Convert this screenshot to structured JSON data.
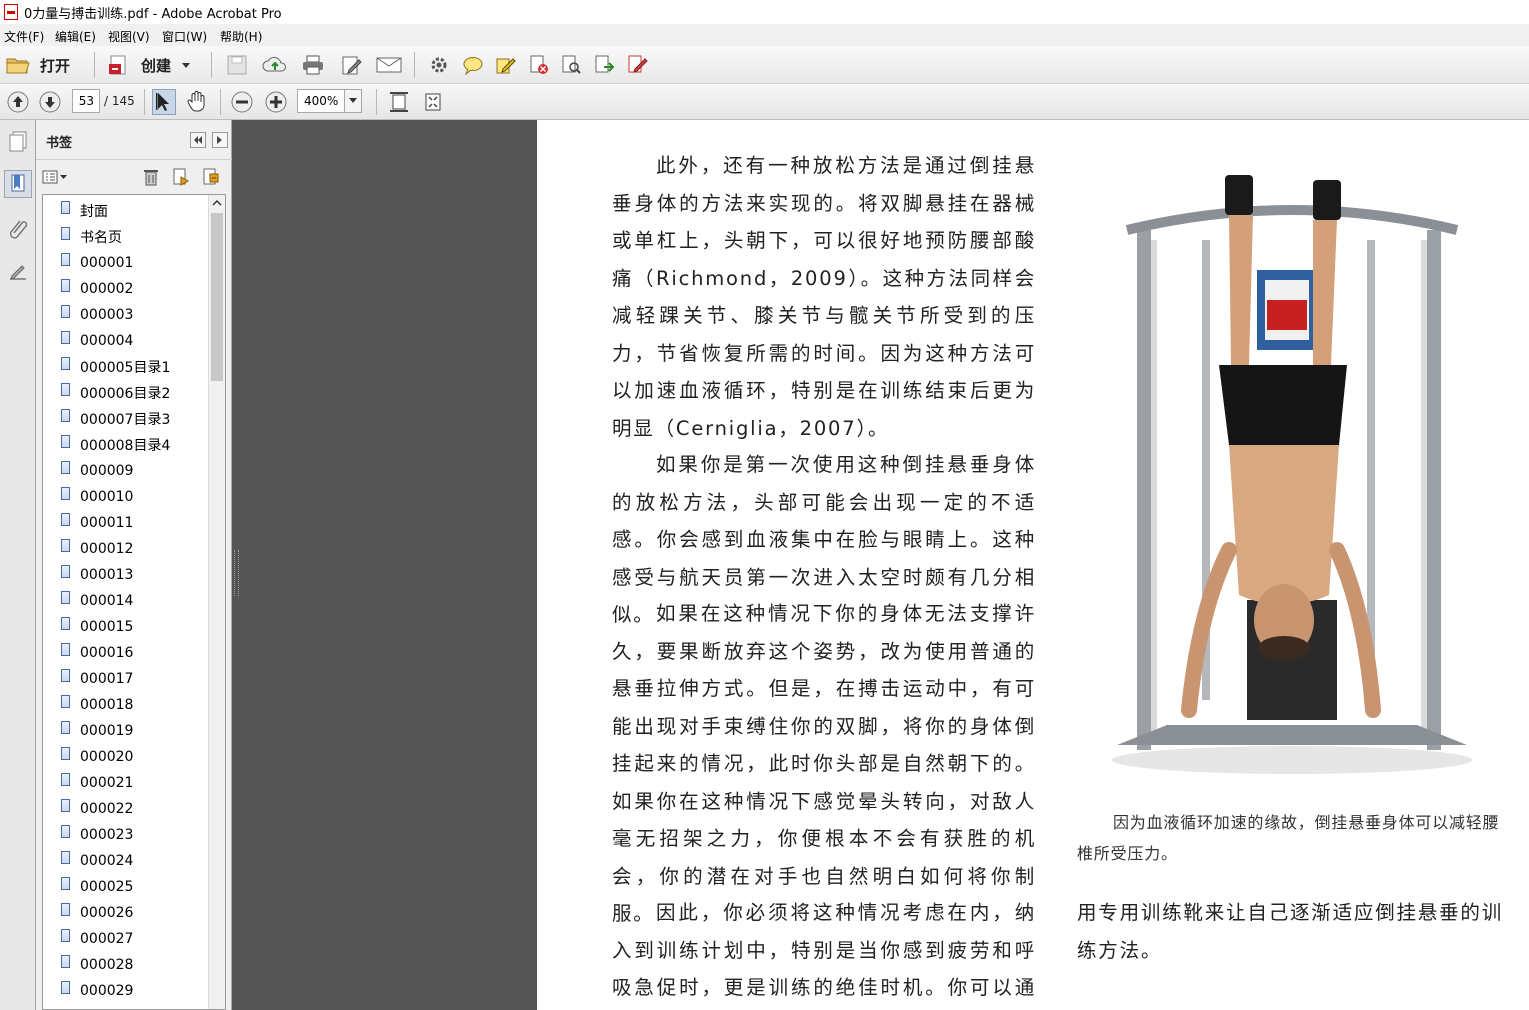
{
  "window": {
    "title": "0力量与搏击训练.pdf - Adobe Acrobat Pro"
  },
  "menu": [
    "文件(F)",
    "编辑(E)",
    "视图(V)",
    "窗口(W)",
    "帮助(H)"
  ],
  "toolbar": {
    "open_label": "打开",
    "create_label": "创建"
  },
  "nav": {
    "page_current": "53",
    "page_total": "/ 145",
    "zoom": "400%"
  },
  "panel": {
    "title": "书签",
    "bookmarks": [
      "封面",
      "书名页",
      "000001",
      "000002",
      "000003",
      "000004",
      "000005目录1",
      "000006目录2",
      "000007目录3",
      "000008目录4",
      "000009",
      "000010",
      "000011",
      "000012",
      "000013",
      "000014",
      "000015",
      "000016",
      "000017",
      "000018",
      "000019",
      "000020",
      "000021",
      "000022",
      "000023",
      "000024",
      "000025",
      "000026",
      "000027",
      "000028",
      "000029"
    ]
  },
  "document": {
    "p1": "此外，还有一种放松方法是通过倒挂悬垂身体的方法来实现的。将双脚悬挂在器械或单杠上，头朝下，可以很好地预防腰部酸痛（Richmond，2009）。这种方法同样会减轻踝关节、膝关节与髋关节所受到的压力，节省恢复所需的时间。因为这种方法可以加速血液循环，特别是在训练结束后更为明显（Cerniglia，2007）。",
    "p2": "如果你是第一次使用这种倒挂悬垂身体的放松方法，头部可能会出现一定的不适感。你会感到血液集中在脸与眼睛上。这种感受与航天员第一次进入太空时颇有几分相似。",
    "p3": "如果在这种情况下你的身体无法支撑许久，要果断放弃这个姿势，改为使用普通的悬垂拉伸方式。但是，在搏击运动中，有可能出现对手束缚住你的双脚，将你的身体倒挂起来的情况，此时你头部是自然朝下的。如果你在这种情况下感觉晕头转向，对敌人毫无招架之力，你便根本不会有获胜的机会，你的潜在对手也自然明白如何将你制服。",
    "p4": "因此，你必须将这种情况考虑在内，纳入到训练计划中，特别是当你感到疲劳和呼吸急促时，更是训练的绝佳时机。你可以通过使",
    "caption": "因为血液循环加速的缘故，倒挂悬垂身体可以减轻腰椎所受压力。",
    "right_para": "用专用训练靴来让自己逐渐适应倒挂悬垂的训练方法。"
  }
}
